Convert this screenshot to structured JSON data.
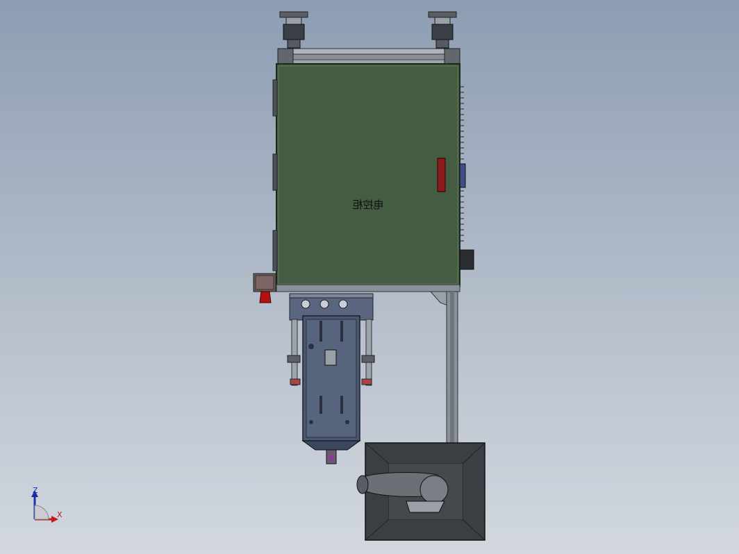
{
  "model": {
    "cabinet_label": "电控柜",
    "cabinet_label_mirrored": true
  },
  "triad": {
    "z_label": "Z",
    "x_label": "X"
  },
  "colors": {
    "background_top": "#8d9db3",
    "background_bottom": "#d3d8df",
    "cabinet_panel": "#435c42",
    "frame_metal": "#8a9099",
    "slide_blue": "#4a5872",
    "base_plate": "#3b3e42",
    "alarm_red": "#8b1a1a",
    "triad_z": "#1c2fa8",
    "triad_x": "#c01c1c"
  }
}
